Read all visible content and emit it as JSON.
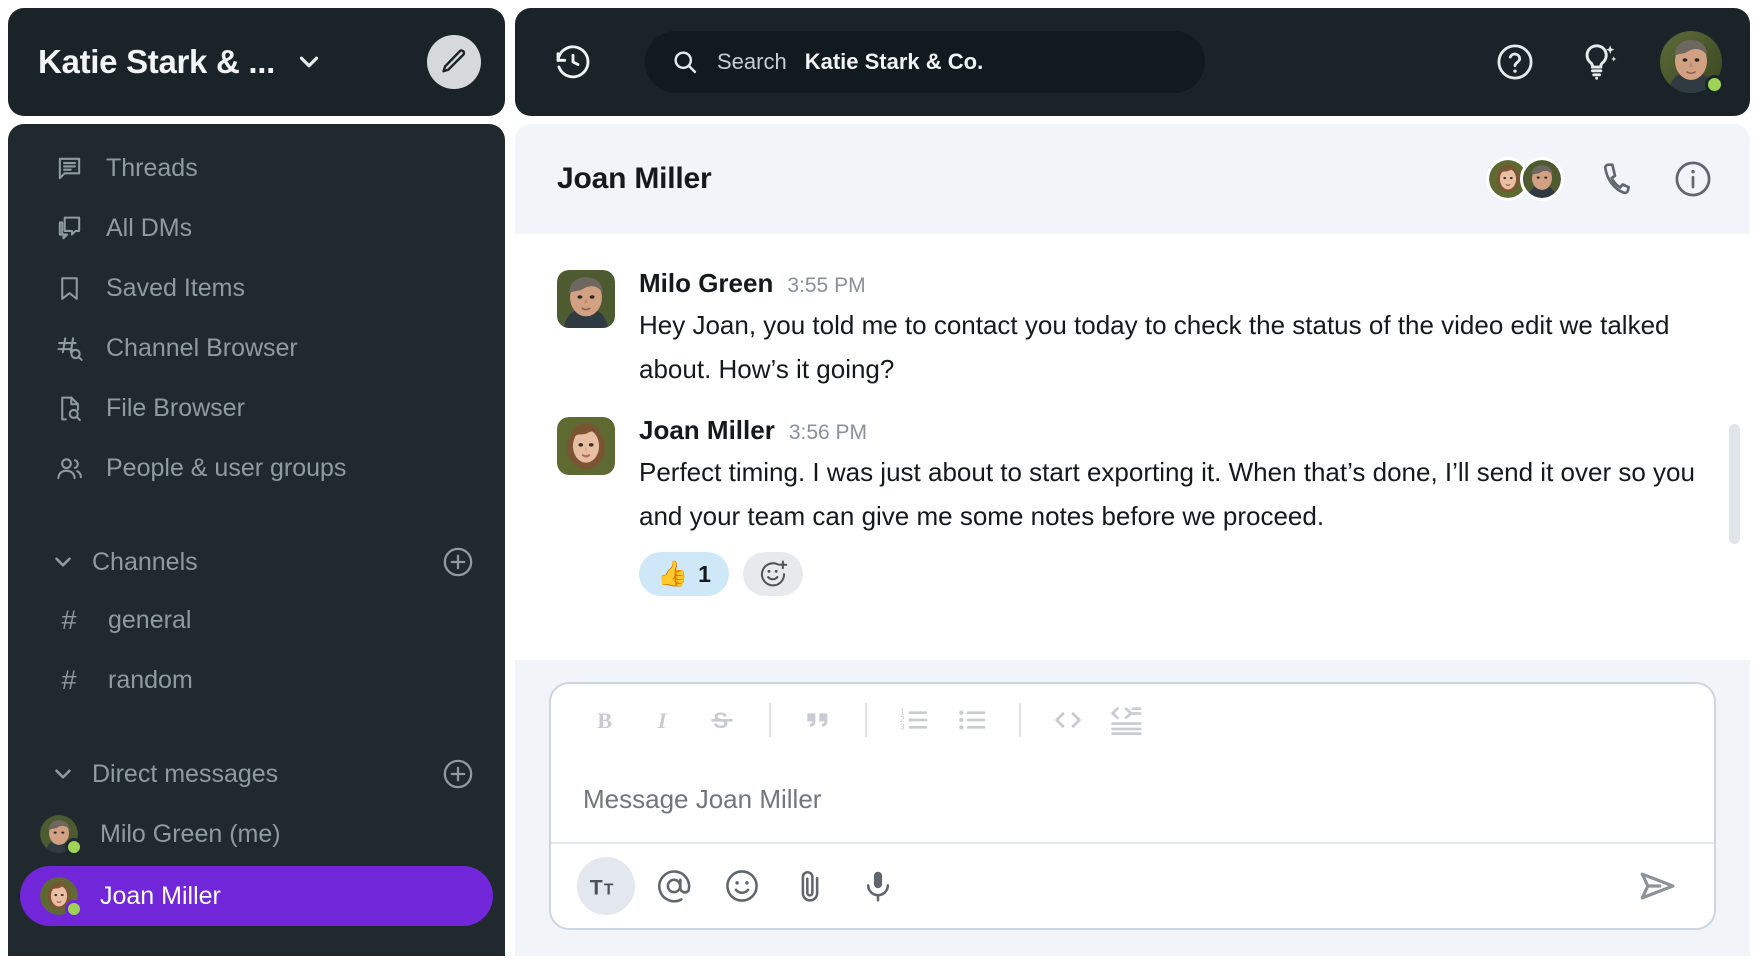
{
  "workspace": {
    "title": "Katie Stark & ...",
    "chevron_icon": "chevron-down-icon",
    "compose_icon": "pencil-icon"
  },
  "topbar": {
    "history_icon": "history-clock-icon",
    "search": {
      "icon": "search-icon",
      "placeholder": "Search",
      "scope": "Katie Stark & Co."
    },
    "help_icon": "question-circle-icon",
    "ai_icon": "lightbulb-sparkle-icon",
    "user_avatar": "milo-green-avatar",
    "user_presence": "online",
    "presence_color": "#9fd356"
  },
  "sidebar": {
    "nav_items": [
      {
        "label": "Threads",
        "icon": "threads-icon"
      },
      {
        "label": "All DMs",
        "icon": "all-dms-icon"
      },
      {
        "label": "Saved Items",
        "icon": "bookmark-icon"
      },
      {
        "label": "Channel Browser",
        "icon": "channel-search-icon"
      },
      {
        "label": "File Browser",
        "icon": "file-search-icon"
      },
      {
        "label": "People & user groups",
        "icon": "people-icon"
      }
    ],
    "channels_section": {
      "label": "Channels",
      "collapse_icon": "chevron-down-icon",
      "add_icon": "plus-circle-icon",
      "items": [
        {
          "name": "general",
          "prefix": "#"
        },
        {
          "name": "random",
          "prefix": "#"
        }
      ]
    },
    "dm_section": {
      "label": "Direct messages",
      "collapse_icon": "chevron-down-icon",
      "add_icon": "plus-circle-icon",
      "items": [
        {
          "name": "Milo Green (me)",
          "presence": "online",
          "active": false
        },
        {
          "name": "Joan Miller",
          "presence": "online",
          "active": true
        }
      ]
    },
    "active_color": "#7226d9"
  },
  "conversation": {
    "title": "Joan Miller",
    "members": [
      "joan-miller-avatar",
      "milo-green-avatar"
    ],
    "call_icon": "phone-icon",
    "info_icon": "info-circle-icon",
    "messages": [
      {
        "author": "Milo Green",
        "time": "3:55 PM",
        "avatar": "milo-green-avatar",
        "text": "Hey Joan, you told me to contact you today to check the status of the video edit we talked about. How’s it going?",
        "reactions": []
      },
      {
        "author": "Joan Miller",
        "time": "3:56 PM",
        "avatar": "joan-miller-avatar",
        "text": "Perfect timing. I was just about to start exporting it. When that’s done, I’ll send it over so you and your team can give me some notes before we proceed.",
        "reactions": [
          {
            "emoji": "👍",
            "count": "1",
            "type": "thumbsup-reaction"
          }
        ],
        "add_reaction_icon": "add-reaction-icon"
      }
    ]
  },
  "composer": {
    "placeholder": "Message Joan Miller",
    "format_buttons": [
      {
        "label": "B",
        "icon": "bold-icon"
      },
      {
        "label": "I",
        "icon": "italic-icon"
      },
      {
        "label": "S",
        "icon": "strikethrough-icon"
      },
      {
        "label": "”",
        "icon": "blockquote-icon"
      },
      {
        "label": "1.",
        "icon": "ordered-list-icon"
      },
      {
        "label": "•",
        "icon": "bullet-list-icon"
      },
      {
        "label": "<>",
        "icon": "code-icon"
      },
      {
        "label": "</>",
        "icon": "code-block-icon"
      }
    ],
    "action_buttons": [
      {
        "icon": "format-text-icon",
        "active": true
      },
      {
        "icon": "mention-icon",
        "active": false
      },
      {
        "icon": "emoji-icon",
        "active": false
      },
      {
        "icon": "attachment-icon",
        "active": false
      },
      {
        "icon": "microphone-icon",
        "active": false
      }
    ],
    "send_icon": "send-icon"
  }
}
